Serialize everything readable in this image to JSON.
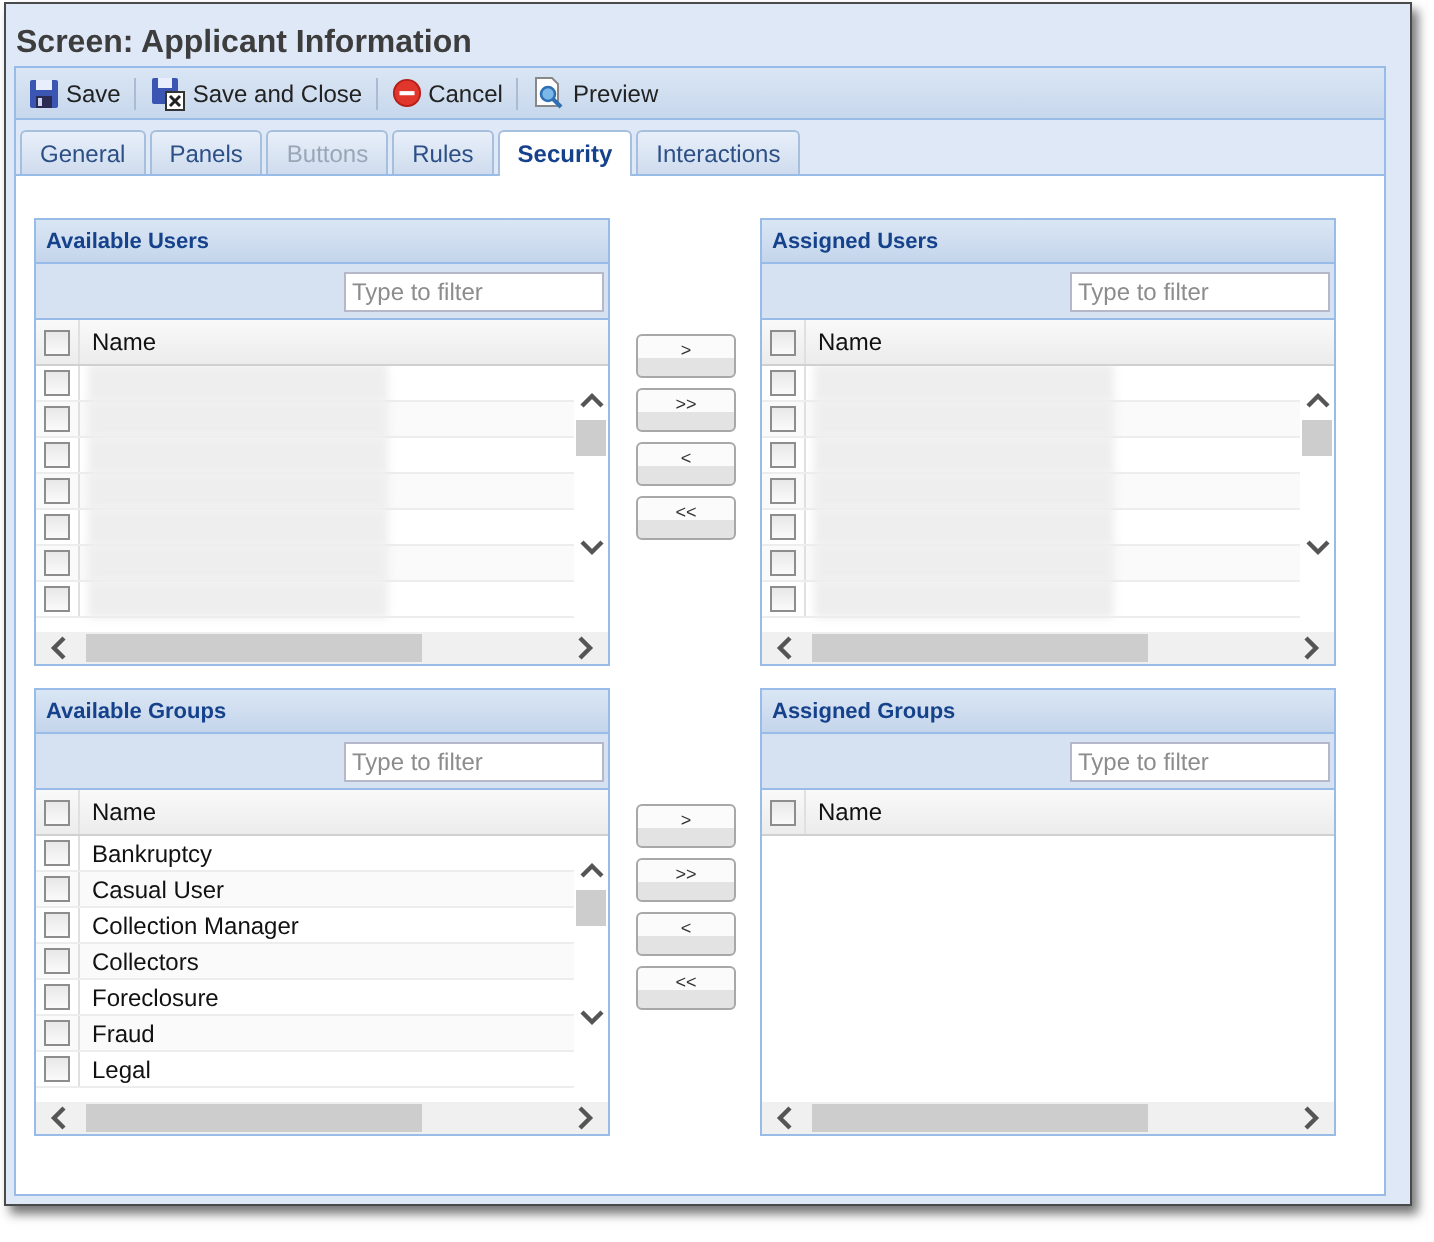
{
  "window": {
    "title": "Screen: Applicant Information"
  },
  "toolbar": [
    {
      "kind": "save",
      "label": "Save"
    },
    {
      "kind": "save_close",
      "label": "Save and Close"
    },
    {
      "kind": "cancel",
      "label": "Cancel"
    },
    {
      "kind": "preview",
      "label": "Preview"
    }
  ],
  "tabs": [
    {
      "label": "General",
      "selected": false,
      "disabled": false
    },
    {
      "label": "Panels",
      "selected": false,
      "disabled": false
    },
    {
      "label": "Buttons",
      "selected": false,
      "disabled": true
    },
    {
      "label": "Rules",
      "selected": false,
      "disabled": false
    },
    {
      "label": "Security",
      "selected": true,
      "disabled": false
    },
    {
      "label": "Interactions",
      "selected": false,
      "disabled": false
    }
  ],
  "sections": [
    {
      "available": {
        "title": "Available Users",
        "filter": {
          "placeholder": "Type to filter"
        },
        "column": "Name",
        "header_checked": false,
        "rows": [
          {
            "kind": "redacted",
            "checked": false
          },
          {
            "kind": "redacted",
            "checked": false
          },
          {
            "kind": "redacted",
            "checked": false
          },
          {
            "kind": "redacted",
            "checked": false
          },
          {
            "kind": "redacted",
            "checked": false
          },
          {
            "kind": "redacted",
            "checked": false
          },
          {
            "kind": "redacted",
            "checked": false
          }
        ]
      },
      "buttons": [
        ">",
        ">>",
        "<",
        "<<"
      ],
      "assigned": {
        "title": "Assigned Users",
        "filter": {
          "placeholder": "Type to filter"
        },
        "column": "Name",
        "header_checked": false,
        "rows": [
          {
            "kind": "redacted",
            "checked": false
          },
          {
            "kind": "redacted",
            "checked": false
          },
          {
            "kind": "redacted",
            "checked": false
          },
          {
            "kind": "redacted",
            "checked": false
          },
          {
            "kind": "redacted",
            "checked": false
          },
          {
            "kind": "redacted",
            "checked": false
          },
          {
            "kind": "redacted",
            "checked": false
          }
        ]
      }
    },
    {
      "available": {
        "title": "Available Groups",
        "filter": {
          "placeholder": "Type to filter"
        },
        "column": "Name",
        "header_checked": false,
        "rows": [
          {
            "kind": "text",
            "label": "Bankruptcy",
            "checked": false
          },
          {
            "kind": "text",
            "label": "Casual User",
            "checked": false
          },
          {
            "kind": "text",
            "label": "Collection Manager",
            "checked": false
          },
          {
            "kind": "text",
            "label": "Collectors",
            "checked": false
          },
          {
            "kind": "text",
            "label": "Foreclosure",
            "checked": false
          },
          {
            "kind": "text",
            "label": "Fraud",
            "checked": false
          },
          {
            "kind": "text",
            "label": "Legal",
            "checked": false
          }
        ]
      },
      "buttons": [
        ">",
        ">>",
        "<",
        "<<"
      ],
      "assigned": {
        "title": "Assigned Groups",
        "filter": {
          "placeholder": "Type to filter"
        },
        "column": "Name",
        "header_checked": false
      }
    }
  ]
}
